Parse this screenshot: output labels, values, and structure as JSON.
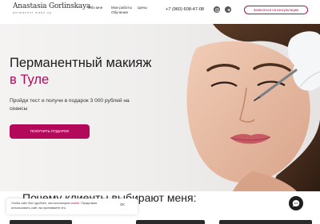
{
  "header": {
    "logo_name": "Anastasia Gorlinskaya",
    "logo_sub": "permanent make-up",
    "nav": {
      "about": "Обо мне",
      "works": "Мои работы",
      "training": "Обучение",
      "prices": "Цены"
    },
    "phone": "+7 (960) 608-47-08",
    "consult_label": "Записаться на консультацию",
    "socials": [
      "instagram-icon",
      "telegram-icon"
    ]
  },
  "hero": {
    "title": "Перманентный макияж",
    "title_accent": "в Туле",
    "text": "Пройди тест и получи в подарок 3 000 рублей на сеансы",
    "button": "ПОЛУЧИТЬ ПОДАРОК"
  },
  "section": {
    "title": "Почему клиенты выбирают меня:"
  },
  "cookie": {
    "text_before": "Чтобы сайт был удобнее, мы используем ",
    "link": "cookie",
    "text_after": ". Продолжая использовать сайт, вы принимаете это.",
    "ok": "OK"
  },
  "colors": {
    "accent": "#b4095a",
    "text": "#1c1c1c",
    "hero_bg": "#f1f0ef"
  }
}
